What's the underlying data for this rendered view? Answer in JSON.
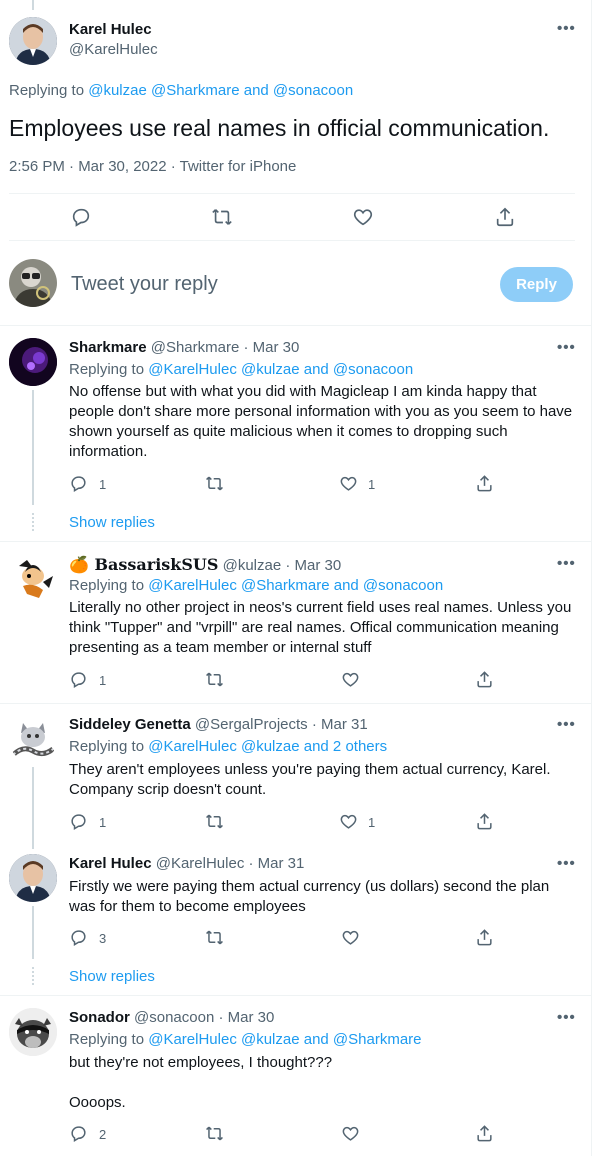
{
  "main_tweet": {
    "name": "Karel Hulec",
    "handle": "@KarelHulec",
    "replying_label": "Replying to",
    "replying_to": "@kulzae @Sharkmare and @sonacoon",
    "text": "Employees use real names in official communication.",
    "timestamp": "2:56 PM · Mar 30, 2022 · Twitter for iPhone"
  },
  "composer": {
    "placeholder": "Tweet your reply",
    "reply_button": "Reply"
  },
  "replies": [
    {
      "name": "Sharkmare",
      "handle": "@Sharkmare · Mar 30",
      "replying_label": "Replying to",
      "replying_to": "@KarelHulec @kulzae and @sonacoon",
      "text": "No offense but with what you did with Magicleap I am kinda happy that people don't share more personal information with you as you seem to have shown yourself as quite malicious when it comes to dropping such information.",
      "reply_count": "1",
      "retweet_count": "",
      "like_count": "1"
    },
    {
      "name": "🍊 𝐁𝐚𝐬𝐬𝐚𝐫𝐢𝐬𝐤𝐒𝐔𝐒",
      "handle": "@kulzae · Mar 30",
      "replying_label": "Replying to",
      "replying_to": "@KarelHulec @Sharkmare and @sonacoon",
      "text": "Literally no other project in neos's current field uses real names. Unless you think \"Tupper\" and \"vrpill\" are real names. Offical communication meaning presenting as a team member or internal stuff",
      "reply_count": "1",
      "retweet_count": "",
      "like_count": ""
    },
    {
      "name": "Siddeley Genetta",
      "handle": "@SergalProjects · Mar 31",
      "replying_label": "Replying to",
      "replying_to": "@KarelHulec @kulzae and 2 others",
      "text": "They aren't employees unless you're paying them actual currency, Karel. Company scrip doesn't count.",
      "reply_count": "1",
      "retweet_count": "",
      "like_count": "1"
    },
    {
      "name": "Karel Hulec",
      "handle": "@KarelHulec · Mar 31",
      "text": "Firstly we were paying them actual currency (us dollars) second the plan was for them to become employees",
      "reply_count": "3",
      "retweet_count": "",
      "like_count": ""
    },
    {
      "name": "Sonador",
      "handle": "@sonacoon · Mar 30",
      "replying_label": "Replying to",
      "replying_to": "@KarelHulec @kulzae and @Sharkmare",
      "text": "but they're not employees, I thought???\n\nOooops.",
      "reply_count": "2",
      "retweet_count": "",
      "like_count": ""
    }
  ],
  "show_replies": [
    "Show replies",
    "Show replies"
  ],
  "icons": {
    "reply": "reply-icon",
    "retweet": "retweet-icon",
    "like": "heart-icon",
    "share": "share-icon",
    "more": "more-icon"
  },
  "colors": {
    "accent": "#1d9bf0",
    "reply_button_disabled": "#8ecdf8",
    "secondary_text": "#536471",
    "divider": "#eff3f4"
  }
}
